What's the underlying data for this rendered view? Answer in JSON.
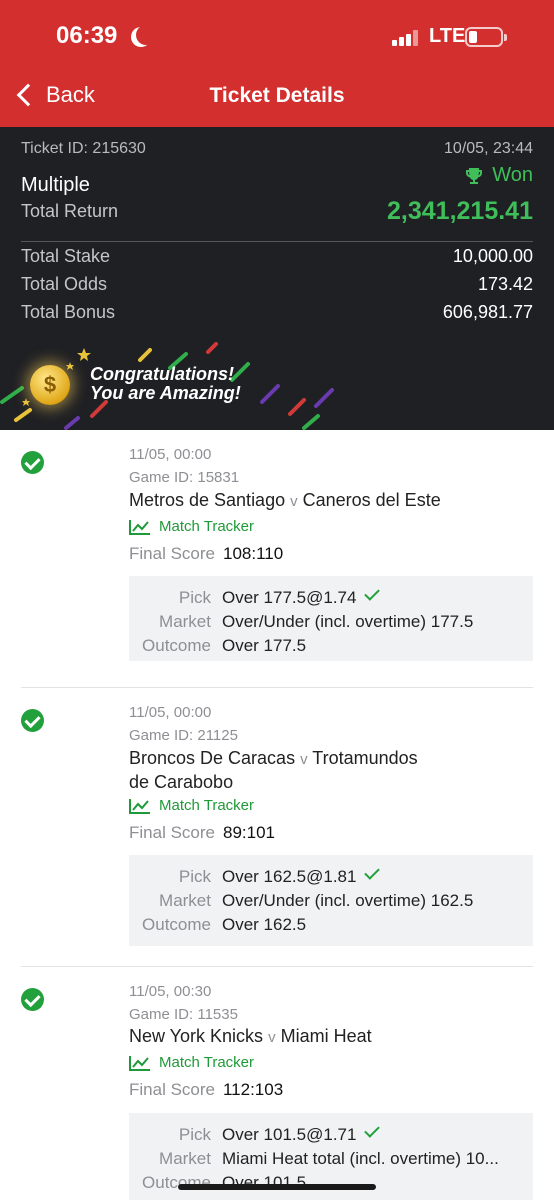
{
  "status_bar": {
    "time": "06:39",
    "network": "LTE"
  },
  "header": {
    "back_label": "Back",
    "title": "Ticket Details"
  },
  "ticket": {
    "id_label": "Ticket ID: 215630",
    "datetime": "10/05, 23:44",
    "type": "Multiple",
    "status": "Won",
    "return_label": "Total Return",
    "return_value": "2,341,215.41",
    "rows": [
      {
        "label": "Total Stake",
        "value": "10,000.00"
      },
      {
        "label": "Total Odds",
        "value": "173.42"
      },
      {
        "label": "Total Bonus",
        "value": "606,981.77"
      }
    ],
    "banner_line1": "Congratulations!",
    "banner_line2": "You are Amazing!"
  },
  "colors": {
    "brand_red": "#d32f2f",
    "won_green": "#3fbe5a",
    "dark_panel": "#1f2024"
  },
  "bets": [
    {
      "date": "11/05, 00:00",
      "game_id": "Game ID: 15831",
      "home": "Metros de Santiago",
      "v": "v",
      "away": "Caneros del Este",
      "tracker": "Match Tracker",
      "score_label": "Final Score",
      "score": "108:110",
      "pick_label": "Pick",
      "pick": "Over 177.5@1.74",
      "market_label": "Market",
      "market": "Over/Under (incl. overtime) 177.5",
      "outcome_label": "Outcome",
      "outcome": "Over 177.5"
    },
    {
      "date": "11/05, 00:00",
      "game_id": "Game ID: 21125",
      "home": "Broncos De Caracas",
      "v": "v",
      "away": "Trotamundos de Carabobo",
      "tracker": "Match Tracker",
      "score_label": "Final Score",
      "score": "89:101",
      "pick_label": "Pick",
      "pick": "Over 162.5@1.81",
      "market_label": "Market",
      "market": "Over/Under (incl. overtime) 162.5",
      "outcome_label": "Outcome",
      "outcome": "Over 162.5"
    },
    {
      "date": "11/05, 00:30",
      "game_id": "Game ID: 11535",
      "home": "New York Knicks",
      "v": "v",
      "away": "Miami Heat",
      "tracker": "Match Tracker",
      "score_label": "Final Score",
      "score": "112:103",
      "pick_label": "Pick",
      "pick": "Over 101.5@1.71",
      "market_label": "Market",
      "market": "Miami Heat total (incl. overtime) 10...",
      "outcome_label": "Outcome",
      "outcome": "Over 101.5"
    }
  ]
}
